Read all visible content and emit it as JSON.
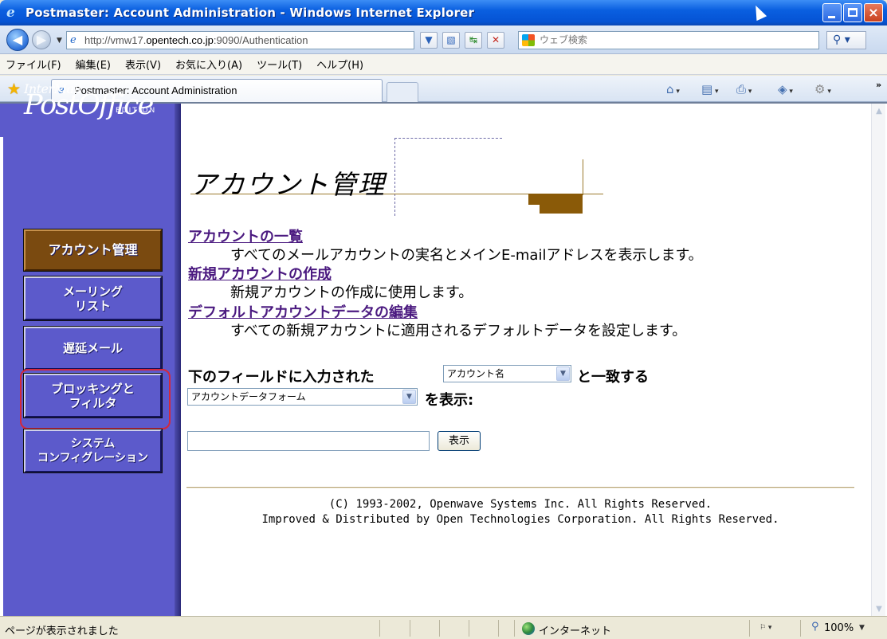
{
  "window": {
    "title": "Postmaster: Account Administration - Windows Internet Explorer",
    "icon": "ie-icon"
  },
  "address": {
    "url_prefix": "http://vmw17.",
    "url_host": "opentech.co.jp",
    "url_suffix": ":9090/Authentication",
    "search_placeholder": "ウェブ検索"
  },
  "menu": [
    "ファイル(F)",
    "編集(E)",
    "表示(V)",
    "お気に入り(A)",
    "ツール(T)",
    "ヘルプ(H)"
  ],
  "tab": {
    "label": "Postmaster: Account Administration"
  },
  "sidebar": {
    "logo_small": "InterMail",
    "logo_big": "PostOffice",
    "logo_edition": "EDITION",
    "buttons": [
      {
        "label": "アカウント管理",
        "active": true
      },
      {
        "label": "メーリング\nリスト"
      },
      {
        "label": "遅延メール"
      },
      {
        "label": "ブロッキングと\nフィルタ",
        "highlighted": true
      },
      {
        "label": "システム\nコンフィグレーション"
      }
    ]
  },
  "main": {
    "title": "アカウント管理",
    "links": [
      {
        "label": "アカウントの一覧",
        "desc": "すべてのメールアカウントの実名とメインE-mailアドレスを表示します。"
      },
      {
        "label": "新規アカウントの作成",
        "desc": "新規アカウントの作成に使用します。"
      },
      {
        "label": "デフォルトアカウントデータの編集",
        "desc": "すべての新規アカウントに適用されるデフォルトデータを設定します。"
      }
    ],
    "form": {
      "label_prefix": "下のフィールドに入力された",
      "field_select": "アカウント名",
      "label_match": "と一致する",
      "view_select": "アカウントデータフォーム",
      "label_show": "を表示:",
      "input_value": "",
      "show_button": "表示"
    },
    "footer": [
      "(C) 1993-2002, Openwave Systems Inc. All Rights Reserved.",
      "Improved & Distributed by Open Technologies Corporation. All Rights Reserved."
    ]
  },
  "status": {
    "text": "ページが表示されました",
    "zone": "インターネット",
    "zoom": "100%"
  },
  "colors": {
    "titlebar": "#0553d4",
    "sidebar": "#5c5acb",
    "active_button": "#7a4a10",
    "link": "#4b1a80",
    "highlight_ring": "#d5283a"
  }
}
